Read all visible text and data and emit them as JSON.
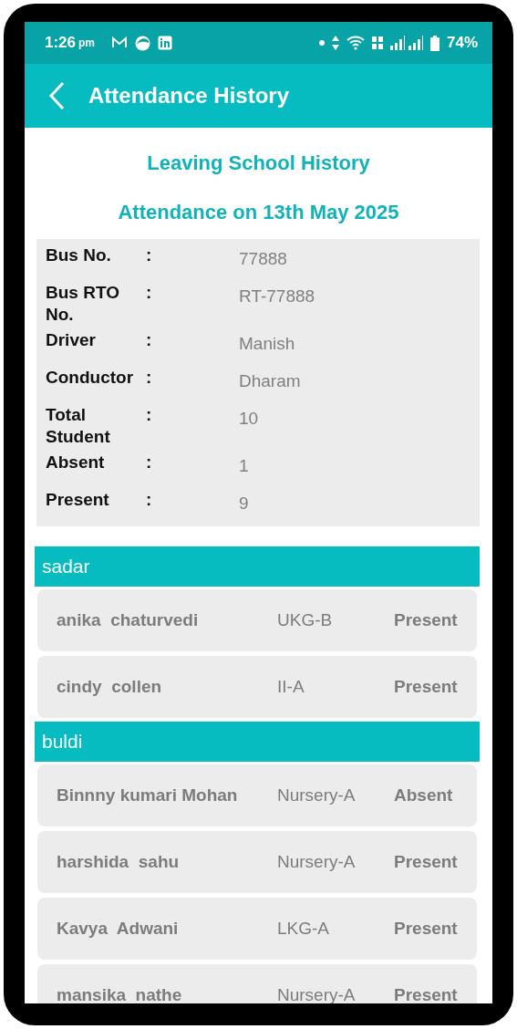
{
  "status_bar": {
    "time": "1:26",
    "meridiem": "pm",
    "battery": "74%"
  },
  "app_bar": {
    "title": "Attendance History"
  },
  "heading": "Leaving School History",
  "subheading": "Attendance on 13th May 2025",
  "details": [
    {
      "label": "Bus No.",
      "separator": ":",
      "value": "77888"
    },
    {
      "label": "Bus RTO No.",
      "separator": ":",
      "value": "RT-77888"
    },
    {
      "label": "Driver",
      "separator": ":",
      "value": "Manish"
    },
    {
      "label": "Conductor",
      "separator": ":",
      "value": "Dharam"
    },
    {
      "label": "Total Student",
      "separator": ":",
      "value": "10"
    },
    {
      "label": "Absent",
      "separator": ":",
      "value": "1"
    },
    {
      "label": "Present",
      "separator": ":",
      "value": "9"
    }
  ],
  "groups": [
    {
      "name": "sadar",
      "students": [
        {
          "name": "anika  chaturvedi",
          "class": "UKG-B",
          "status": "Present"
        },
        {
          "name": "cindy  collen",
          "class": "II-A",
          "status": "Present"
        }
      ]
    },
    {
      "name": "buldi",
      "students": [
        {
          "name": "Binnny kumari Mohan",
          "class": "Nursery-A",
          "status": "Absent"
        },
        {
          "name": "harshida  sahu",
          "class": "Nursery-A",
          "status": "Present"
        },
        {
          "name": "Kavya  Adwani",
          "class": "LKG-A",
          "status": "Present"
        },
        {
          "name": "mansika  nathe",
          "class": "Nursery-A",
          "status": "Present"
        }
      ]
    }
  ]
}
